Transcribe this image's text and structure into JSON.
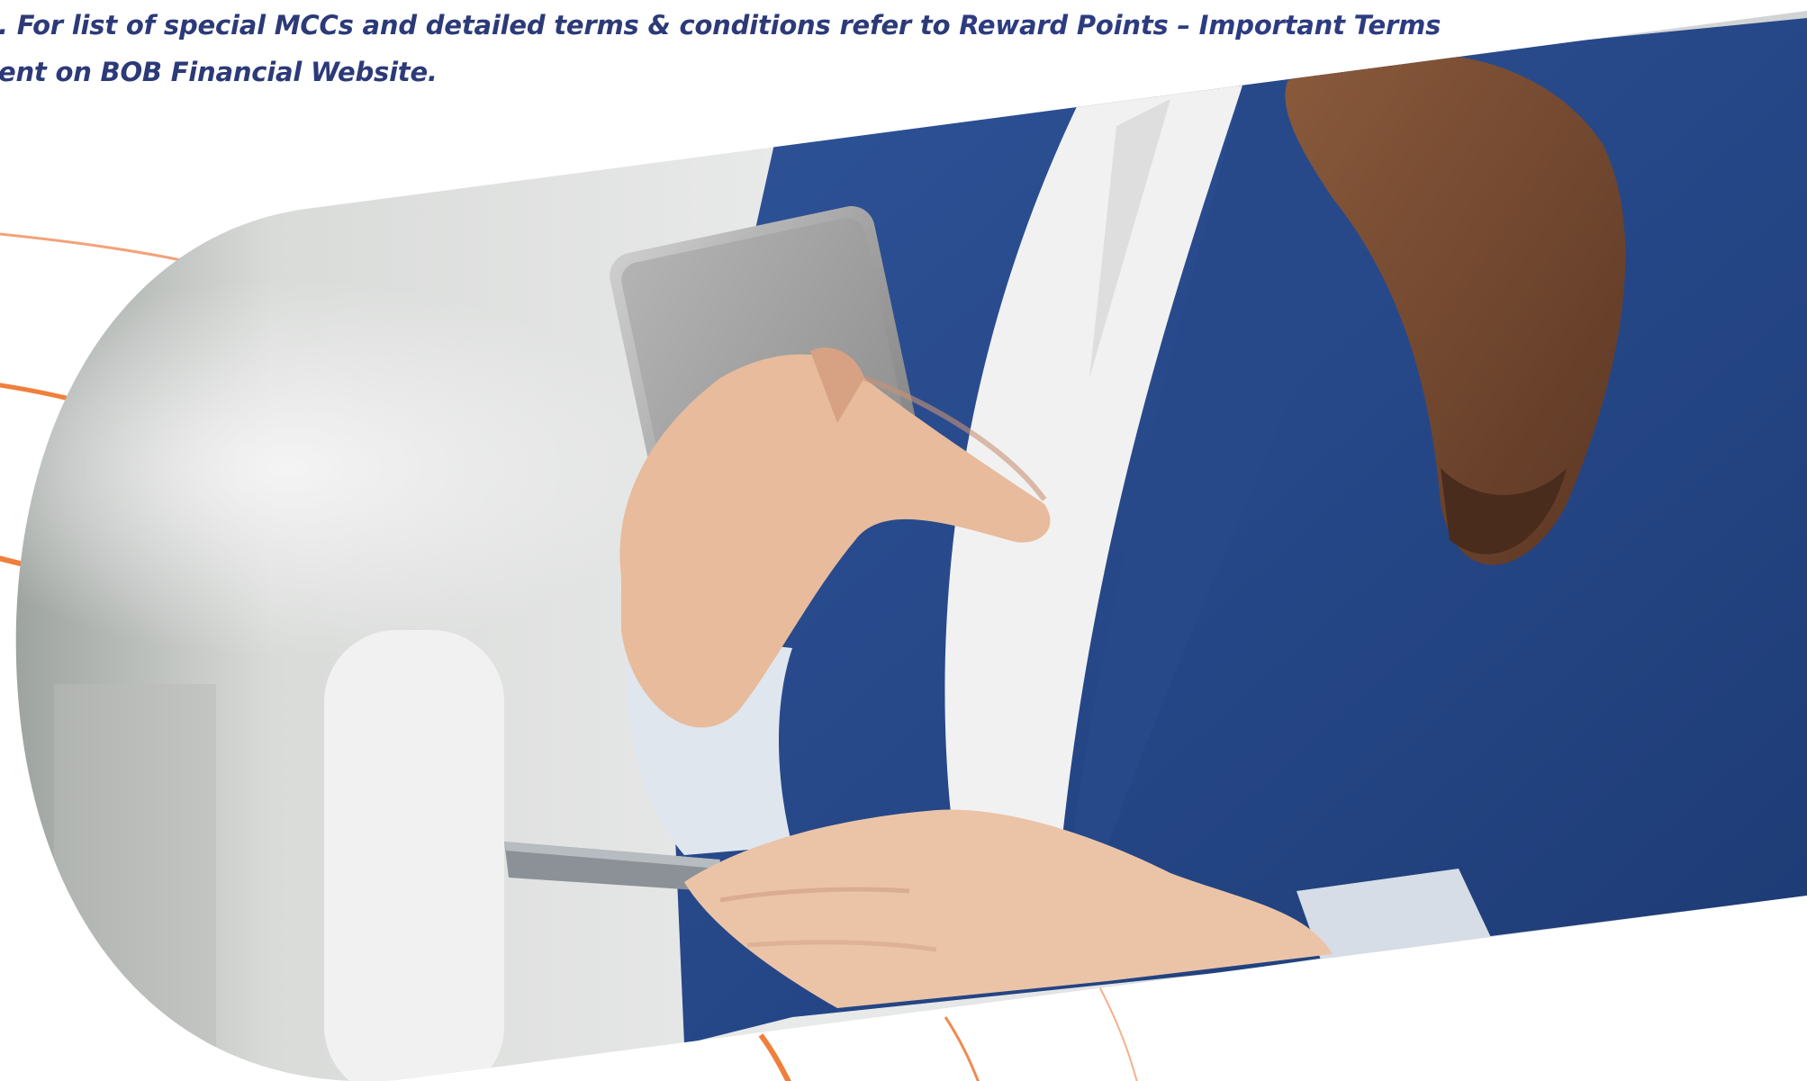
{
  "note": {
    "line1_prefix": ". For list of special MCCs and detailed terms & conditions refer to ",
    "line1_link": "Reward Points – Important Terms",
    "line2": "ent on BOB Financial Website."
  },
  "hero_image": {
    "subject": "woman-holding-phone-and-credit-card",
    "colors": {
      "blazer": "#2a4a8f",
      "shirt": "#f2f2f2",
      "hair": "#7a4a2e",
      "skin": "#e8bfa3",
      "phone": "#a9a9a9",
      "card": "#8e9399",
      "background": "#dcdcdc",
      "accent_lines": "#f07f3c"
    }
  }
}
